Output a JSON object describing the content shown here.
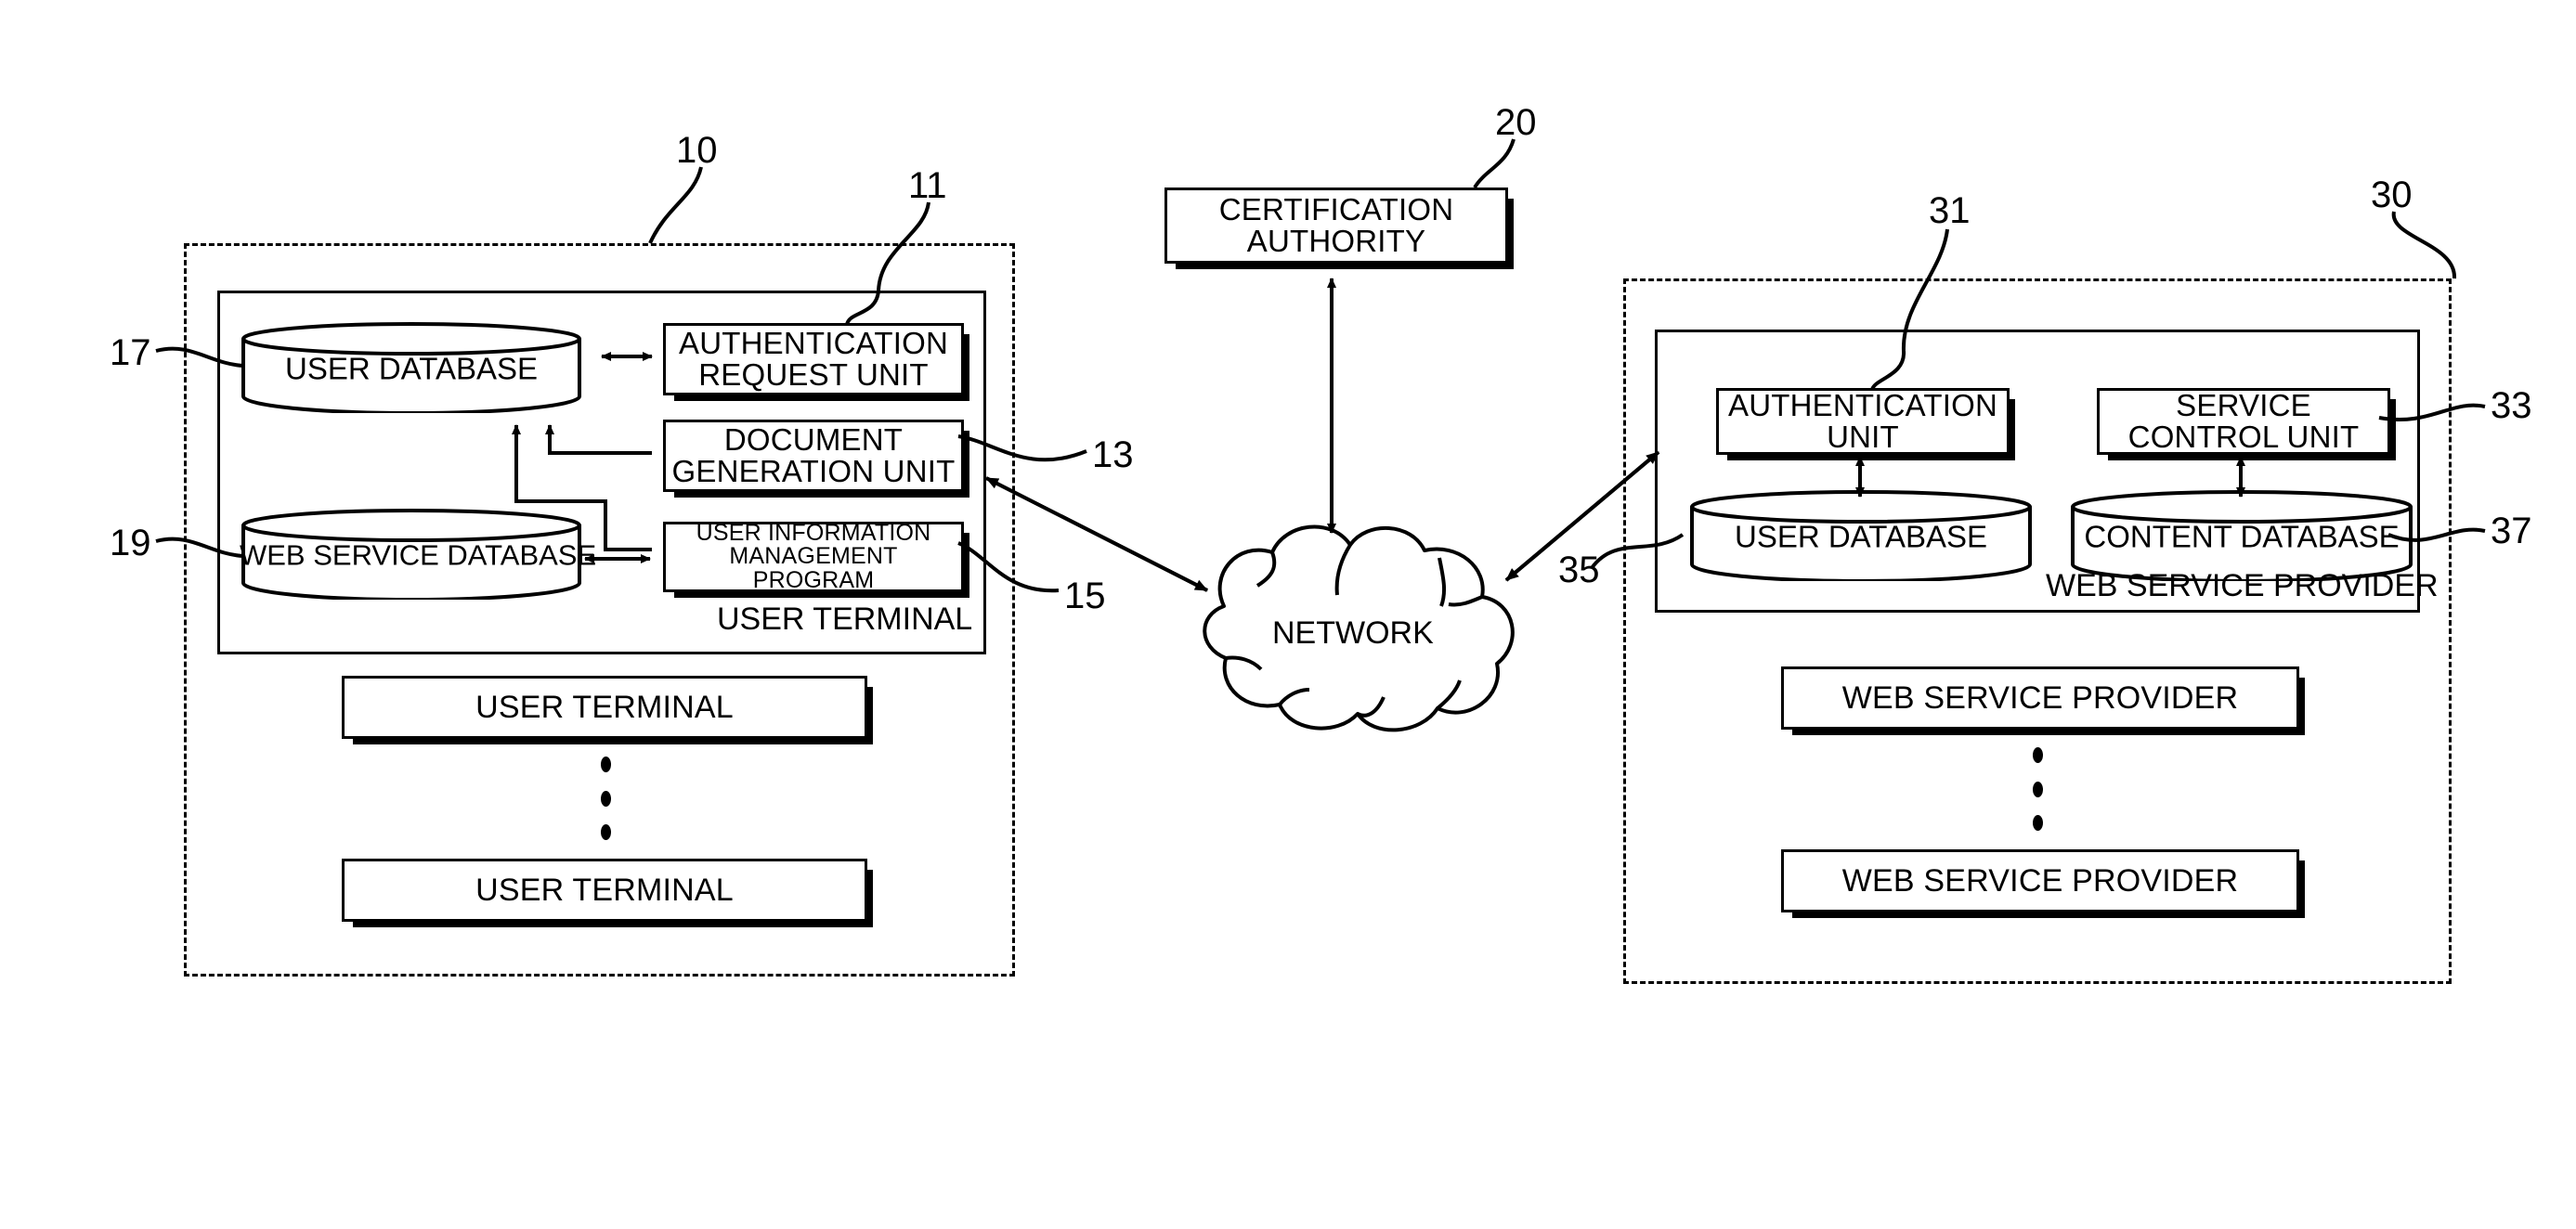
{
  "figure": {
    "title": "Web service authentication system block diagram",
    "ink_color": "#000000",
    "background_color": "#ffffff"
  },
  "user_side": {
    "group_ref": "10",
    "terminal_caption": "USER TERMINAL",
    "modules": [
      {
        "ref": "11",
        "label_line1": "AUTHENTICATION",
        "label_line2": "REQUEST UNIT"
      },
      {
        "ref": "13",
        "label_line1": "DOCUMENT",
        "label_line2": "GENERATION UNIT"
      },
      {
        "ref": "15",
        "label_line1": "USER INFORMATION",
        "label_line2": "MANAGEMENT PROGRAM"
      }
    ],
    "databases": [
      {
        "ref": "17",
        "label": "USER DATABASE"
      },
      {
        "ref": "19",
        "label": "WEB SERVICE DATABASE"
      }
    ],
    "extra_terminals": [
      {
        "label": "USER TERMINAL"
      },
      {
        "label": "USER TERMINAL"
      }
    ]
  },
  "certification": {
    "ref": "20",
    "label_line1": "CERTIFICATION",
    "label_line2": "AUTHORITY"
  },
  "network": {
    "label": "NETWORK"
  },
  "provider_side": {
    "group_ref": "30",
    "provider_caption": "WEB SERVICE PROVIDER",
    "link_ref": "35",
    "modules": [
      {
        "ref": "31",
        "label_line1": "AUTHENTICATION",
        "label_line2": "UNIT"
      },
      {
        "ref": "33",
        "label_line1": "SERVICE",
        "label_line2": "CONTROL UNIT"
      }
    ],
    "databases": [
      {
        "ref": "",
        "label": "USER DATABASE"
      },
      {
        "ref": "37",
        "label": "CONTENT DATABASE"
      }
    ],
    "extra_providers": [
      {
        "label": "WEB SERVICE PROVIDER"
      },
      {
        "label": "WEB SERVICE PROVIDER"
      }
    ]
  }
}
